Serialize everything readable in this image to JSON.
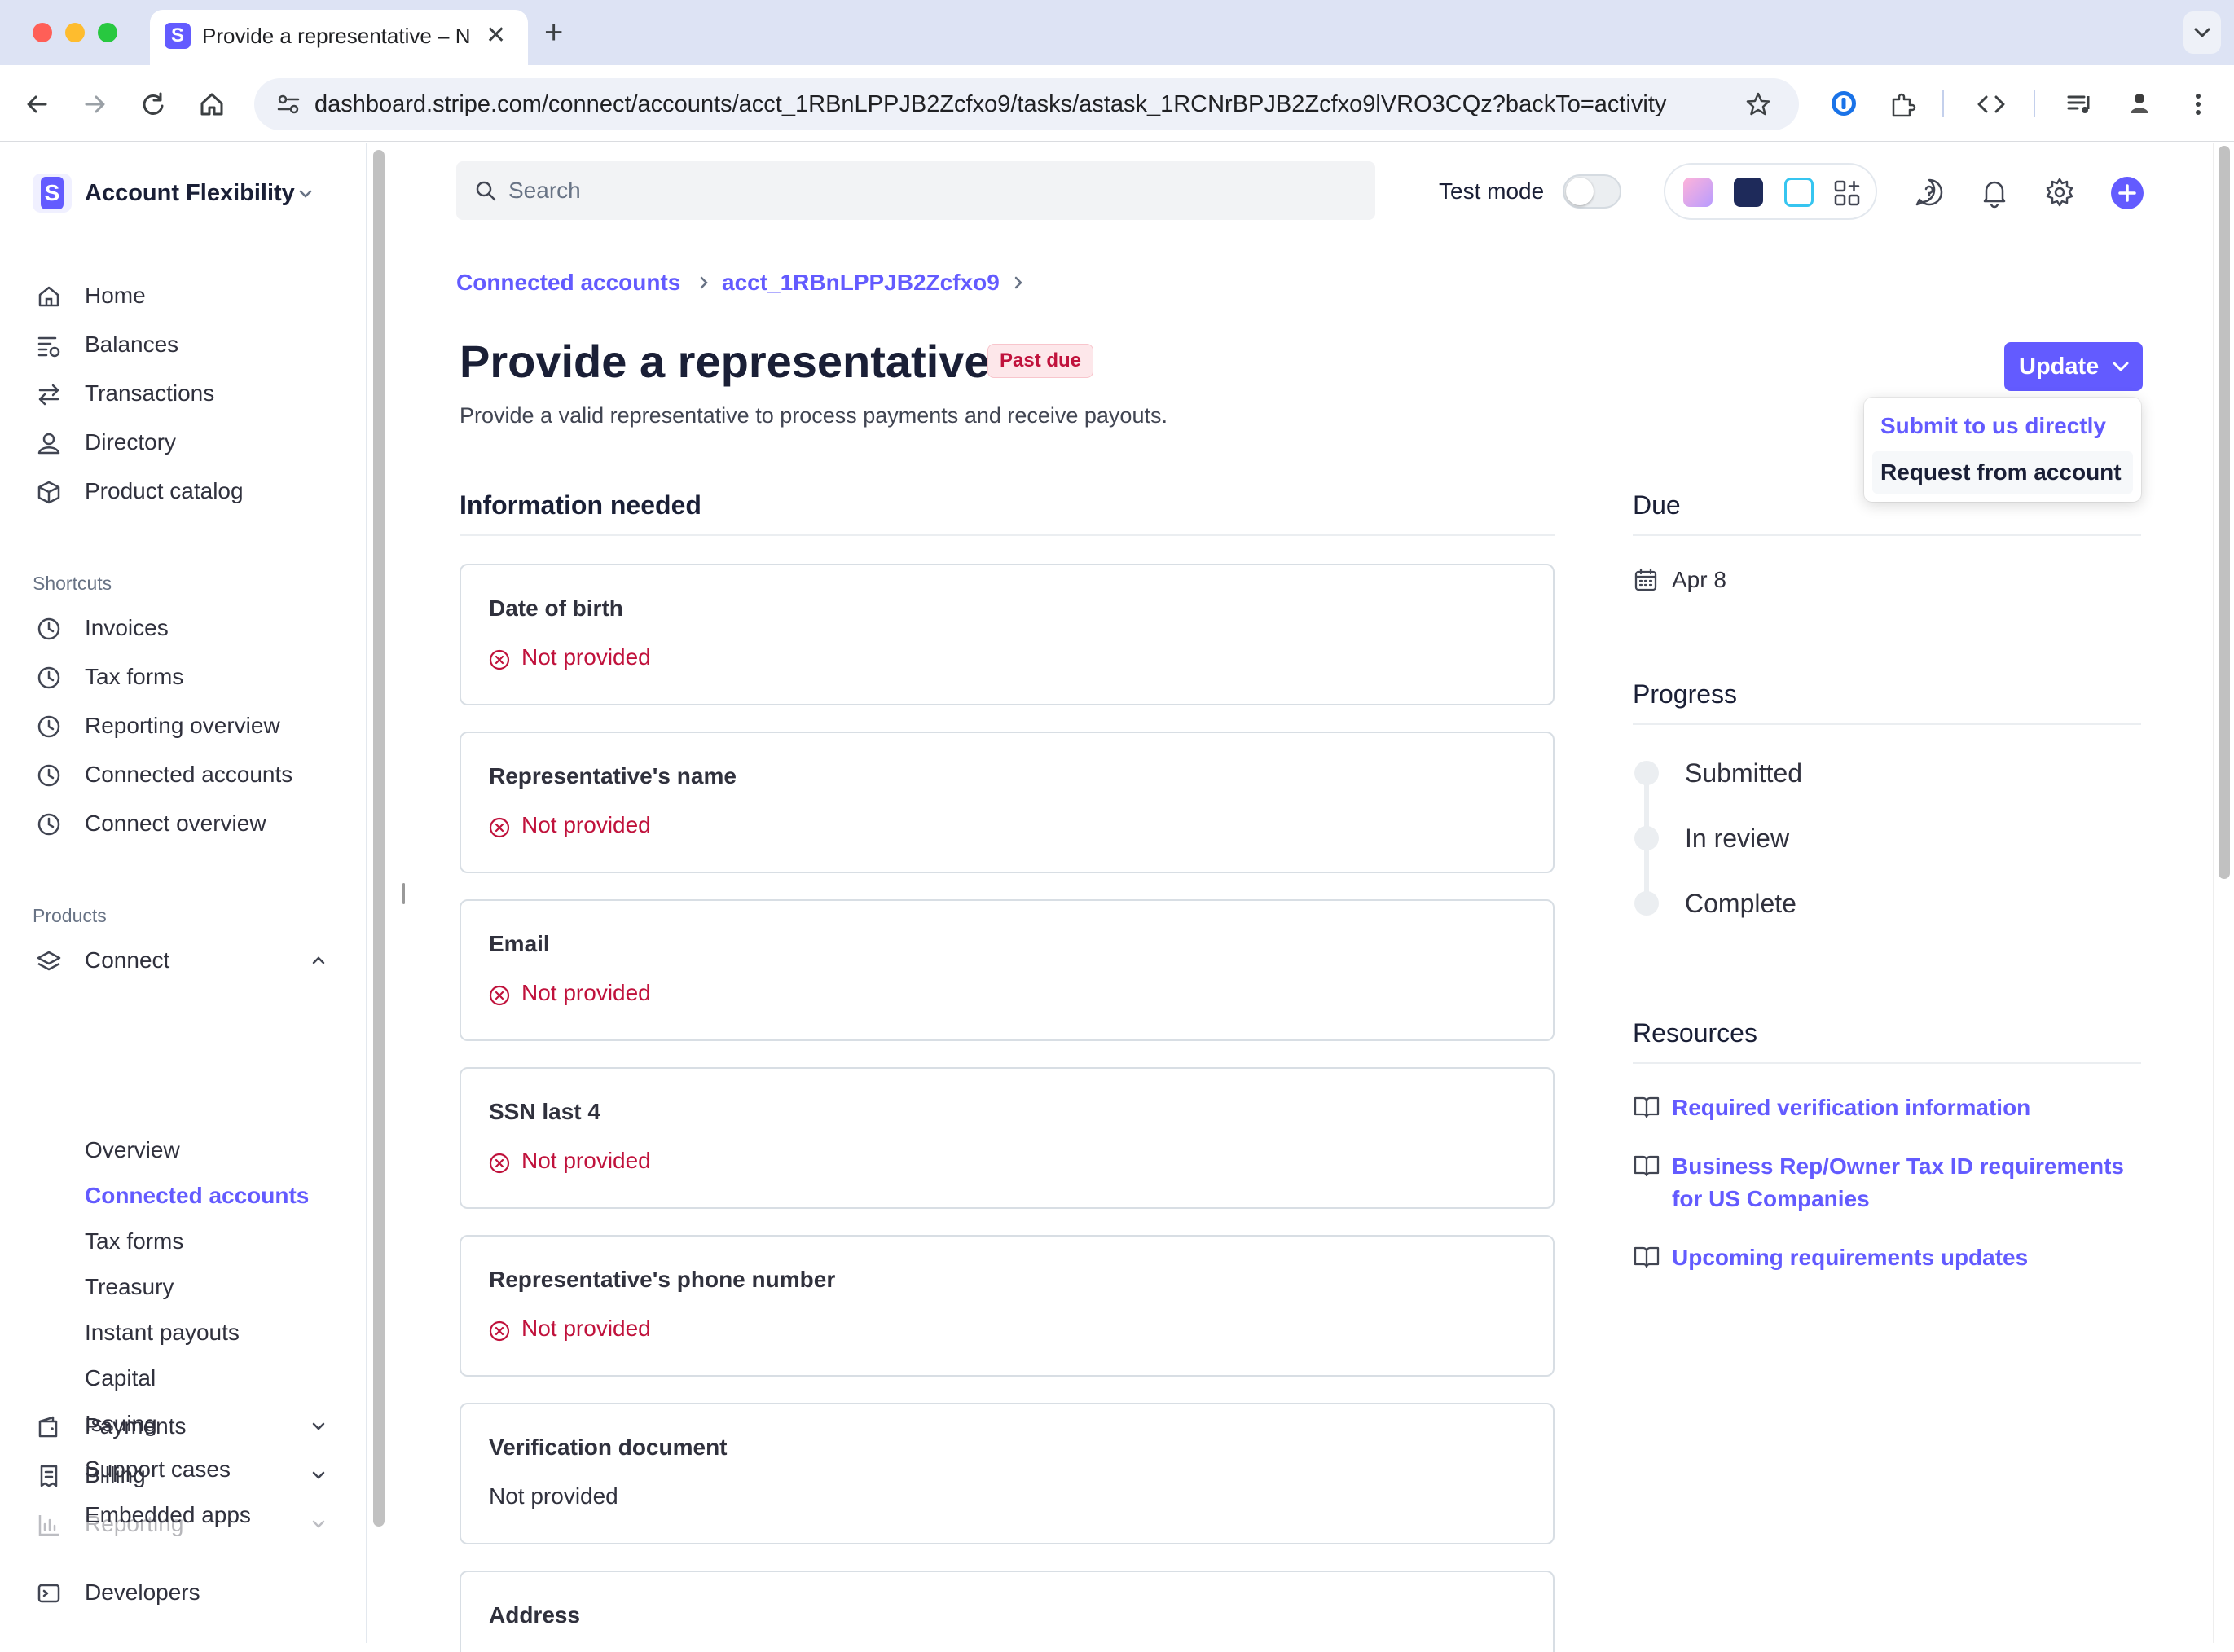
{
  "browser": {
    "tab_title": "Provide a representative – Ne",
    "url": "dashboard.stripe.com/connect/accounts/acct_1RBnLPPJB2Zcfxo9/tasks/astask_1RCNrBPJB2Zcfxo9lVRO3CQz?backTo=activity",
    "favicon_letter": "S"
  },
  "sidebar": {
    "account_name": "Account Flexibility",
    "logo_letter": "S",
    "main_items": [
      {
        "label": "Home",
        "icon": "home-icon"
      },
      {
        "label": "Balances",
        "icon": "balances-icon"
      },
      {
        "label": "Transactions",
        "icon": "transactions-icon"
      },
      {
        "label": "Directory",
        "icon": "user-icon"
      },
      {
        "label": "Product catalog",
        "icon": "box-icon"
      }
    ],
    "shortcuts_heading": "Shortcuts",
    "shortcuts": [
      {
        "label": "Invoices",
        "icon": "clock-icon"
      },
      {
        "label": "Tax forms",
        "icon": "clock-icon"
      },
      {
        "label": "Reporting overview",
        "icon": "clock-icon"
      },
      {
        "label": "Connected accounts",
        "icon": "clock-icon"
      },
      {
        "label": "Connect overview",
        "icon": "clock-icon"
      }
    ],
    "products_heading": "Products",
    "connect_label": "Connect",
    "connect_sub": [
      {
        "label": "Overview",
        "active": false
      },
      {
        "label": "Connected accounts",
        "active": true
      },
      {
        "label": "Tax forms",
        "active": false
      },
      {
        "label": "Treasury",
        "active": false
      },
      {
        "label": "Instant payouts",
        "active": false
      },
      {
        "label": "Capital",
        "active": false
      },
      {
        "label": "Issuing",
        "active": false
      },
      {
        "label": "Support cases",
        "active": false
      },
      {
        "label": "Embedded apps",
        "active": false
      }
    ],
    "payments_label": "Payments",
    "billing_label": "Billing",
    "reporting_label": "Reporting",
    "developers_label": "Developers"
  },
  "header": {
    "search_placeholder": "Search",
    "test_mode_label": "Test mode",
    "test_mode_on": false
  },
  "breadcrumb": {
    "items": [
      "Connected accounts",
      "acct_1RBnLPPJB2Zcfxo9"
    ]
  },
  "page": {
    "title": "Provide a representative",
    "badge": "Past due",
    "subtitle": "Provide a valid representative to process payments and receive payouts.",
    "update_button": "Update",
    "dropdown_options": [
      "Submit to us directly",
      "Request from account"
    ]
  },
  "information": {
    "heading": "Information needed",
    "items": [
      {
        "title": "Date of birth",
        "status": "Not provided",
        "error": true
      },
      {
        "title": "Representative's name",
        "status": "Not provided",
        "error": true
      },
      {
        "title": "Email",
        "status": "Not provided",
        "error": true
      },
      {
        "title": "SSN last 4",
        "status": "Not provided",
        "error": true
      },
      {
        "title": "Representative's phone number",
        "status": "Not provided",
        "error": true
      },
      {
        "title": "Verification document",
        "status": "Not provided",
        "error": false
      },
      {
        "title": "Address",
        "status": "",
        "error": false
      }
    ]
  },
  "due": {
    "heading": "Due",
    "date": "Apr 8"
  },
  "progress": {
    "heading": "Progress",
    "steps": [
      "Submitted",
      "In review",
      "Complete"
    ]
  },
  "resources": {
    "heading": "Resources",
    "links": [
      "Required verification information",
      "Business Rep/Owner Tax ID requirements for US Companies",
      "Upcoming requirements updates"
    ]
  },
  "colors": {
    "accent": "#635bff",
    "error": "#c0123c",
    "badge_bg": "#fde7ea"
  }
}
